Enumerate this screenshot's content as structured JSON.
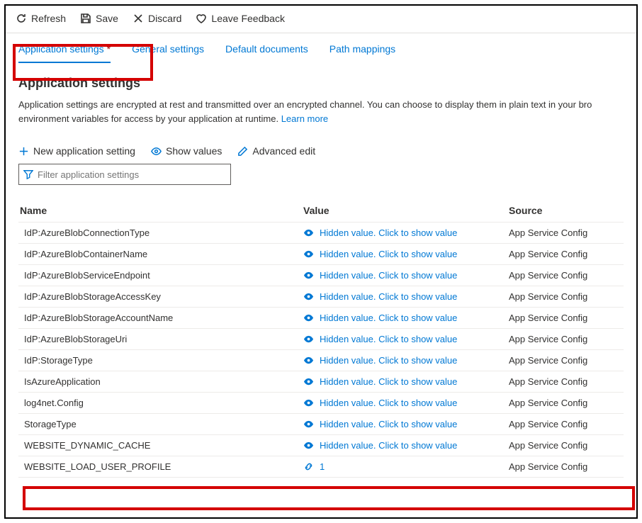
{
  "toolbar": {
    "refresh": "Refresh",
    "save": "Save",
    "discard": "Discard",
    "feedback": "Leave Feedback"
  },
  "tabs": {
    "app_settings": "Application settings",
    "general": "General settings",
    "default_docs": "Default documents",
    "path_mappings": "Path mappings"
  },
  "heading": "Application settings",
  "description_pre": "Application settings are encrypted at rest and transmitted over an encrypted channel. You can choose to display them in plain text in your bro",
  "description_line2": "environment variables for access by your application at runtime. ",
  "learn_more": "Learn more",
  "actions": {
    "new_setting": "New application setting",
    "show_values": "Show values",
    "advanced_edit": "Advanced edit"
  },
  "filter_placeholder": "Filter application settings",
  "columns": {
    "name": "Name",
    "value": "Value",
    "source": "Source"
  },
  "hidden_text": "Hidden value. Click to show value",
  "source_text": "App Service Config",
  "rows": [
    {
      "name": "IdP:AzureBlobConnectionType",
      "hidden": true
    },
    {
      "name": "IdP:AzureBlobContainerName",
      "hidden": true
    },
    {
      "name": "IdP:AzureBlobServiceEndpoint",
      "hidden": true
    },
    {
      "name": "IdP:AzureBlobStorageAccessKey",
      "hidden": true
    },
    {
      "name": "IdP:AzureBlobStorageAccountName",
      "hidden": true
    },
    {
      "name": "IdP:AzureBlobStorageUri",
      "hidden": true
    },
    {
      "name": "IdP:StorageType",
      "hidden": true
    },
    {
      "name": "IsAzureApplication",
      "hidden": true
    },
    {
      "name": "log4net.Config",
      "hidden": true
    },
    {
      "name": "StorageType",
      "hidden": true
    },
    {
      "name": "WEBSITE_DYNAMIC_CACHE",
      "hidden": true
    },
    {
      "name": "WEBSITE_LOAD_USER_PROFILE",
      "hidden": false,
      "value": "1"
    }
  ]
}
